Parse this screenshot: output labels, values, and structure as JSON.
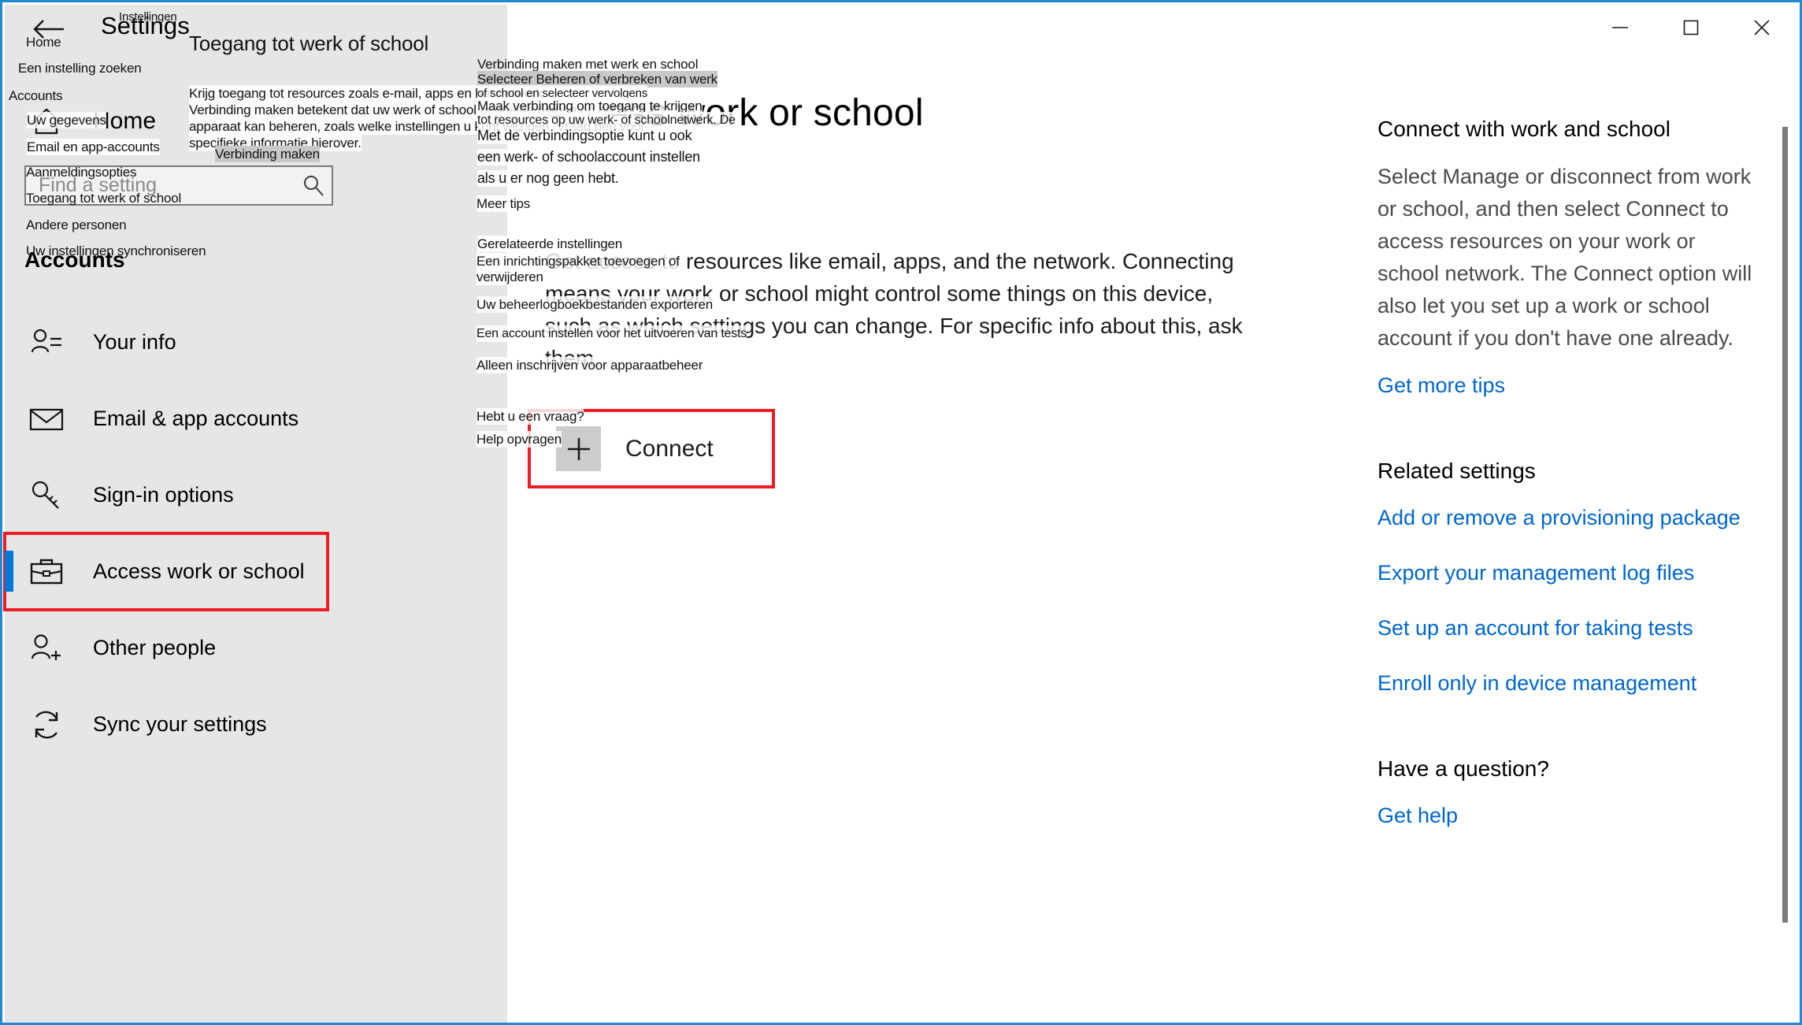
{
  "window": {
    "app_title": "Settings",
    "accent_color": "#1f8ad2",
    "selection_color": "#0078d7",
    "highlight_color": "#ee1c25",
    "link_color": "#0066cc",
    "caption": {
      "minimize": "minimize-icon",
      "maximize": "maximize-icon",
      "close": "close-icon"
    }
  },
  "nav": {
    "back_icon": "back-arrow-icon",
    "home": {
      "icon": "home-icon",
      "label": "Home"
    },
    "search": {
      "value": "",
      "placeholder": "Find a setting",
      "icon": "search-icon"
    },
    "section_title": "Accounts",
    "items": [
      {
        "label": "Your info",
        "icon": "user-info-icon",
        "selected": false,
        "highlighted": false
      },
      {
        "label": "Email & app accounts",
        "icon": "envelope-icon",
        "selected": false,
        "highlighted": false
      },
      {
        "label": "Sign-in options",
        "icon": "key-icon",
        "selected": false,
        "highlighted": false
      },
      {
        "label": "Access work or school",
        "icon": "briefcase-icon",
        "selected": true,
        "highlighted": true
      },
      {
        "label": "Other people",
        "icon": "add-person-icon",
        "selected": false,
        "highlighted": false
      },
      {
        "label": "Sync your settings",
        "icon": "sync-icon",
        "selected": false,
        "highlighted": false
      }
    ]
  },
  "page": {
    "heading": "Access work or school",
    "body": "Get access to resources like email, apps, and the network. Connecting means your work or school might control some things on this device, such as which settings you can change. For specific info about this, ask them.",
    "connect": {
      "label": "Connect",
      "icon": "plus-icon",
      "highlighted": true
    }
  },
  "rail": {
    "tips_heading": "Connect with work and school",
    "tips_body": "Select Manage or disconnect from work or school, and then select Connect to access resources on your work or school network. The Connect option will also let you set up a work or school account if you don't have one already.",
    "tips_link": "Get more tips",
    "related_heading": "Related settings",
    "related_links": [
      "Add or remove a provisioning package",
      "Export your management log files",
      "Set up an account for taking tests",
      "Enroll only in device management"
    ],
    "question_heading": "Have a question?",
    "question_link": "Get help"
  },
  "overlay": {
    "language": "nl",
    "items": [
      {
        "id": "o-instellingen",
        "text": "Instellingen"
      },
      {
        "id": "o-home",
        "text": "Home"
      },
      {
        "id": "o-zoeken",
        "text": "Een instelling zoeken"
      },
      {
        "id": "o-accounts",
        "text": "Accounts"
      },
      {
        "id": "o-gegevens",
        "text": "Uw gegevens"
      },
      {
        "id": "o-email",
        "text": "Email en app-accounts"
      },
      {
        "id": "o-aanmelding",
        "text": "Aanmeldingsopties"
      },
      {
        "id": "o-toegang",
        "text": "Toegang tot werk of school"
      },
      {
        "id": "o-andere",
        "text": "Andere personen"
      },
      {
        "id": "o-sync",
        "text": "Uw instellingen synchroniseren"
      },
      {
        "id": "o-paneltitle",
        "text": "Toegang tot werk of school"
      },
      {
        "id": "o-body1",
        "text": "Krijg toegang tot resources zoals e-mail, apps en het netwerk."
      },
      {
        "id": "o-body2",
        "text": "Verbinding maken betekent dat uw werk of school bepaalde dingen op dit"
      },
      {
        "id": "o-body3",
        "text": "apparaat kan beheren, zoals welke instellingen u kunt wijzigen. Vraag hen voor"
      },
      {
        "id": "o-body4",
        "text": "specifieke informatie hierover."
      },
      {
        "id": "o-verbinding-maken",
        "text": "Verbinding maken"
      },
      {
        "id": "o-r1",
        "text": "Verbinding maken met werk en school"
      },
      {
        "id": "o-r2",
        "text": "Selecteer Beheren of verbreken van werk"
      },
      {
        "id": "o-r3",
        "text": "of school en selecteer vervolgens"
      },
      {
        "id": "o-r4",
        "text": "Maak verbinding om toegang te krijgen"
      },
      {
        "id": "o-r5",
        "text": "tot resources op uw werk- of schoolnetwerk. De"
      },
      {
        "id": "o-r6",
        "text": "Met de verbindingsoptie kunt u ook"
      },
      {
        "id": "o-r7",
        "text": "een werk- of schoolaccount instellen"
      },
      {
        "id": "o-r8",
        "text": "als u er nog geen hebt."
      },
      {
        "id": "o-meertips",
        "text": "Meer tips"
      },
      {
        "id": "o-gerelateerde",
        "text": "Gerelateerde instellingen"
      },
      {
        "id": "o-inrichting1",
        "text": "Een inrichtingspakket toevoegen of"
      },
      {
        "id": "o-inrichting2",
        "text": "verwijderen"
      },
      {
        "id": "o-logboek",
        "text": "Uw beheerlogboekbestanden exporteren"
      },
      {
        "id": "o-tests",
        "text": "Een account instellen voor het uitvoeren van tests"
      },
      {
        "id": "o-apparaatbeheer",
        "text": "Alleen inschrijven voor apparaatbeheer"
      },
      {
        "id": "o-vraag",
        "text": "Hebt u een vraag?"
      },
      {
        "id": "o-help",
        "text": "Help opvragen"
      }
    ]
  }
}
